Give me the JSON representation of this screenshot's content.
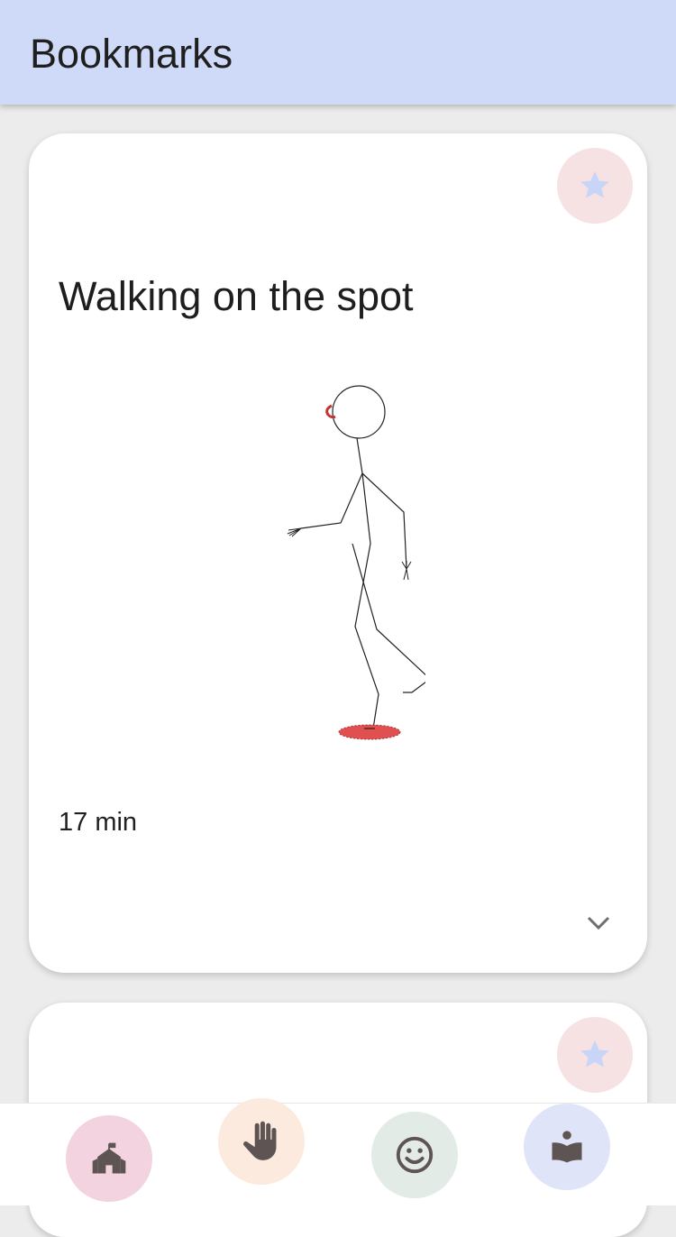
{
  "app_bar": {
    "title": "Bookmarks"
  },
  "cards": [
    {
      "title": "Walking on the spot",
      "duration": "17 min",
      "bookmark_icon": "star-icon",
      "expand_icon": "chevron-down-icon",
      "illustration": "walking-stick-figure"
    },
    {
      "bookmark_icon": "star-icon"
    }
  ],
  "bottom_nav": {
    "items": [
      {
        "icon": "school-icon"
      },
      {
        "icon": "hand-icon"
      },
      {
        "icon": "smiley-icon"
      },
      {
        "icon": "reading-icon"
      }
    ]
  },
  "colors": {
    "app_bar": "#cfdaf8",
    "background": "#ececec",
    "bookmark_button": "#f6e1e3",
    "star": "#c9d5f6",
    "nav_home": "#f2d3df",
    "nav_hand": "#fbeadd",
    "nav_face": "#e2ebe6",
    "nav_read": "#dfe4f8",
    "nav_icon": "#5f5454",
    "accent_red": "#e05050"
  }
}
